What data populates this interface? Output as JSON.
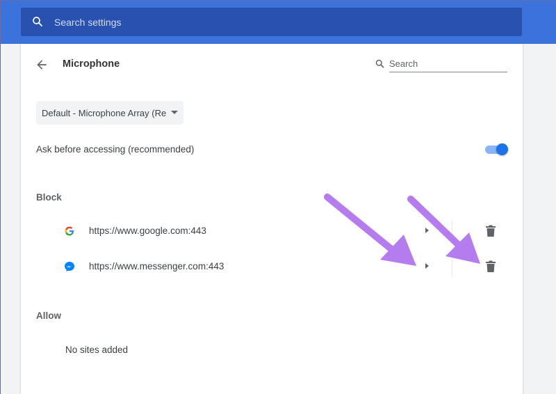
{
  "header": {
    "search_placeholder": "Search settings",
    "search_value": ""
  },
  "page": {
    "title": "Microphone",
    "search_placeholder": "Search",
    "device_selected": "Default - Microphone Array (Re",
    "ask_label": "Ask before accessing (recommended)",
    "ask_enabled": true
  },
  "block": {
    "title": "Block",
    "sites": [
      {
        "url": "https://www.google.com:443",
        "favicon": "google-favicon"
      },
      {
        "url": "https://www.messenger.com:443",
        "favicon": "messenger-favicon"
      }
    ]
  },
  "allow": {
    "title": "Allow",
    "empty_text": "No sites added"
  },
  "colors": {
    "header_bg": "#3c72dc",
    "search_bg": "#2851b0",
    "accent": "#1a73e8",
    "toggle_track": "#8ab4f8",
    "annotation_arrow": "#b57cf0"
  },
  "icons": {
    "header_search": "search-icon",
    "back": "back-arrow-icon",
    "sub_search": "search-icon",
    "row_expand": "arrow-right-icon",
    "row_delete": "trash-icon"
  }
}
